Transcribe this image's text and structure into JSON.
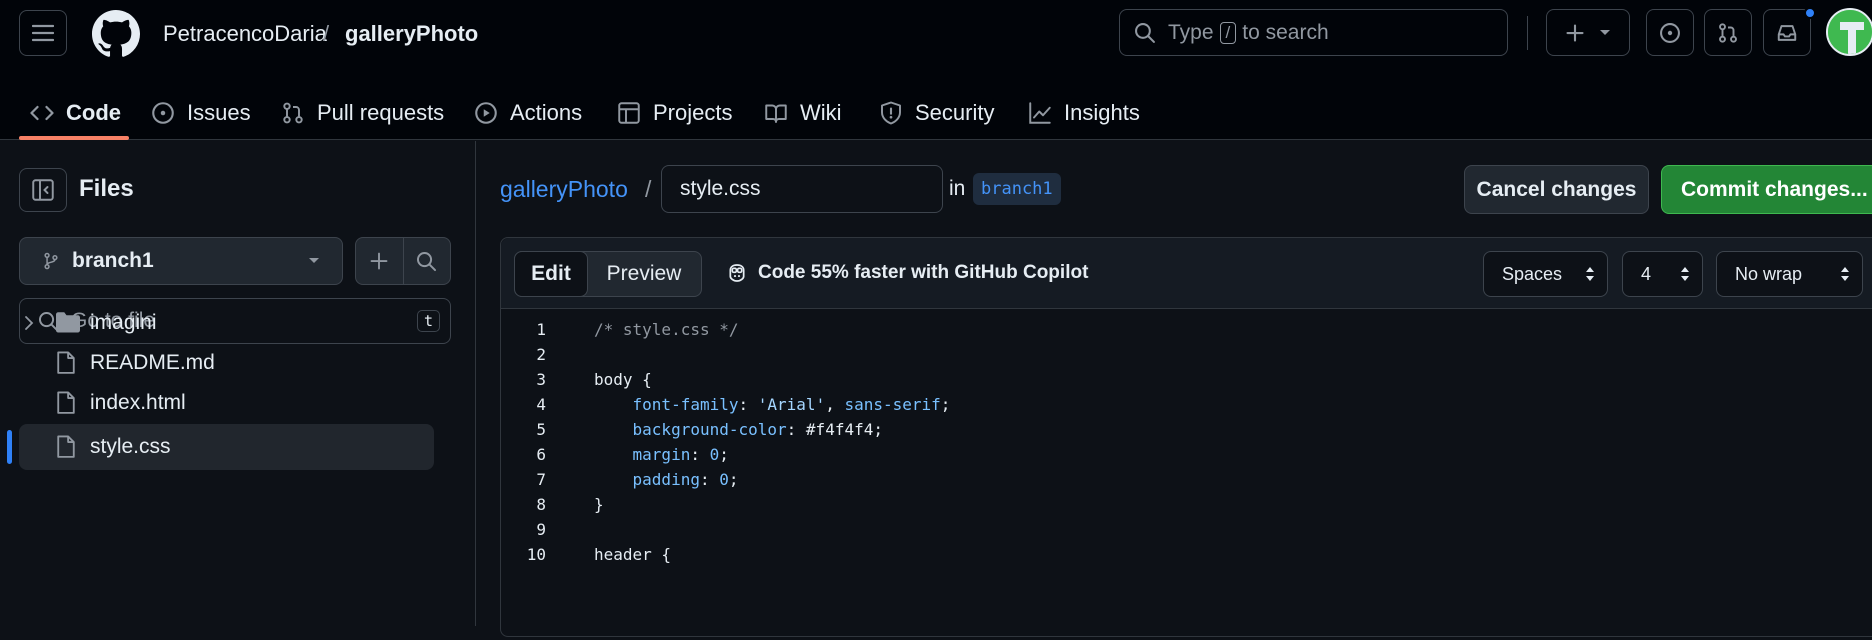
{
  "header": {
    "owner": "PetracencoDaria",
    "separator": "/",
    "repo": "galleryPhoto",
    "search_prefix": "Type",
    "search_key": "/",
    "search_suffix": "to search"
  },
  "tabs": [
    {
      "label": "Code",
      "icon": "code-icon",
      "active": true
    },
    {
      "label": "Issues",
      "icon": "issue-icon"
    },
    {
      "label": "Pull requests",
      "icon": "pull-request-icon"
    },
    {
      "label": "Actions",
      "icon": "play-icon"
    },
    {
      "label": "Projects",
      "icon": "table-icon"
    },
    {
      "label": "Wiki",
      "icon": "book-icon"
    },
    {
      "label": "Security",
      "icon": "shield-icon"
    },
    {
      "label": "Insights",
      "icon": "graph-icon"
    }
  ],
  "sidebar": {
    "title": "Files",
    "branch": "branch1",
    "goto_placeholder": "Go to file",
    "goto_shortcut": "t",
    "tree": [
      {
        "name": "imagini",
        "type": "folder"
      },
      {
        "name": "README.md",
        "type": "file"
      },
      {
        "name": "index.html",
        "type": "file"
      },
      {
        "name": "style.css",
        "type": "file",
        "selected": true
      }
    ]
  },
  "editor": {
    "path_repo": "galleryPhoto",
    "path_separator": "/",
    "filename": "style.css",
    "in_label": "in",
    "branch": "branch1",
    "cancel_label": "Cancel changes",
    "commit_label": "Commit changes...",
    "mode_edit": "Edit",
    "mode_preview": "Preview",
    "copilot_text": "Code 55% faster with GitHub Copilot",
    "indent_mode": "Spaces",
    "indent_size": "4",
    "wrap_mode": "No wrap",
    "lines": [
      {
        "n": "1",
        "parts": [
          [
            "c-comment",
            "/* style.css */"
          ]
        ]
      },
      {
        "n": "2",
        "parts": []
      },
      {
        "n": "3",
        "parts": [
          [
            "c-plain",
            "body {"
          ]
        ]
      },
      {
        "n": "4",
        "parts": [
          [
            "c-plain",
            "    "
          ],
          [
            "c-prop",
            "font-family"
          ],
          [
            "c-plain",
            ": "
          ],
          [
            "c-str",
            "'Arial'"
          ],
          [
            "c-plain",
            ", "
          ],
          [
            "c-prop",
            "sans-serif"
          ],
          [
            "c-plain",
            ";"
          ]
        ]
      },
      {
        "n": "5",
        "parts": [
          [
            "c-plain",
            "    "
          ],
          [
            "c-prop",
            "background-color"
          ],
          [
            "c-plain",
            ": #f4f4f4;"
          ]
        ]
      },
      {
        "n": "6",
        "parts": [
          [
            "c-plain",
            "    "
          ],
          [
            "c-prop",
            "margin"
          ],
          [
            "c-plain",
            ": "
          ],
          [
            "c-num",
            "0"
          ],
          [
            "c-plain",
            ";"
          ]
        ]
      },
      {
        "n": "7",
        "parts": [
          [
            "c-plain",
            "    "
          ],
          [
            "c-prop",
            "padding"
          ],
          [
            "c-plain",
            ": "
          ],
          [
            "c-num",
            "0"
          ],
          [
            "c-plain",
            ";"
          ]
        ]
      },
      {
        "n": "8",
        "parts": [
          [
            "c-plain",
            "}"
          ]
        ]
      },
      {
        "n": "9",
        "parts": []
      },
      {
        "n": "10",
        "parts": [
          [
            "c-plain",
            "header {"
          ]
        ]
      }
    ]
  },
  "colors": {
    "accent": "#2f81f7",
    "commit_green": "#238636",
    "tab_underline": "#f78166",
    "link": "#4493f8"
  }
}
